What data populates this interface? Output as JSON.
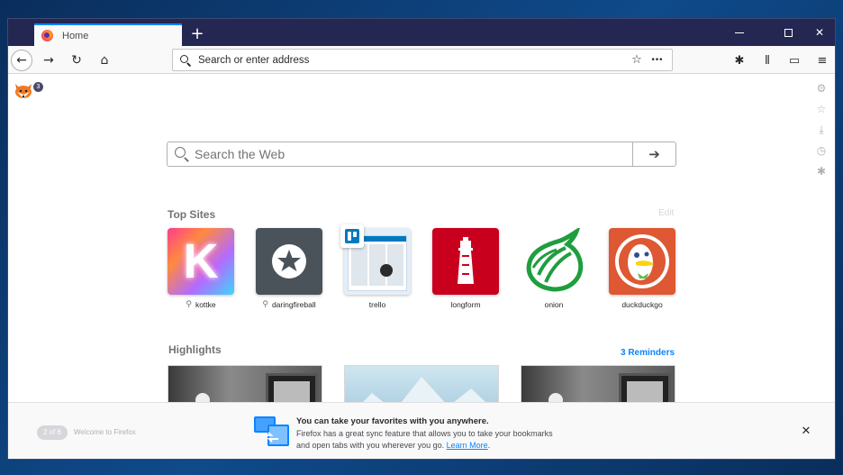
{
  "tab": {
    "title": "Home"
  },
  "newtab": {
    "symbol": "+"
  },
  "window_controls": {
    "minimize": "—",
    "maximize": "☐",
    "close": "✕"
  },
  "nav": {
    "back": "←",
    "forward": "→",
    "reload": "↻",
    "home": "⌂"
  },
  "urlbar": {
    "placeholder": "Search or enter address",
    "bookmark_icon": "☆",
    "page_actions": "•••"
  },
  "toolbar": {
    "extension": "✱",
    "library": "⫴",
    "sidebar": "▭",
    "menu": "≡"
  },
  "extension_badge": "3",
  "search": {
    "placeholder": "Search the Web",
    "go": "➔"
  },
  "top_sites": {
    "title": "Top Sites",
    "edit": "Edit",
    "sites": [
      {
        "label": "kottke",
        "pinned": true
      },
      {
        "label": "daringfireball",
        "pinned": true
      },
      {
        "label": "trello",
        "pinned": false
      },
      {
        "label": "longform",
        "pinned": false
      },
      {
        "label": "onion",
        "pinned": false
      },
      {
        "label": "duckduckgo",
        "pinned": false
      }
    ],
    "kottke_letter": "K"
  },
  "highlights": {
    "title": "Highlights",
    "reminders": "3 Reminders"
  },
  "onboarding": {
    "pager": "2 of 6",
    "welcome": "Welcome to Firefox",
    "title": "You can take your favorites with you anywhere.",
    "body_line1": "Firefox has a great sync feature that allows you to take your bookmarks",
    "body_line2": "and open tabs with you wherever you go.",
    "link": "Learn More",
    "period": ".",
    "close": "✕"
  },
  "colors": {
    "accent": "#0a84ff",
    "titlebar": "#232751",
    "longform": "#d70022",
    "onion": "#1f9e3f",
    "duckduckgo": "#de5833"
  }
}
